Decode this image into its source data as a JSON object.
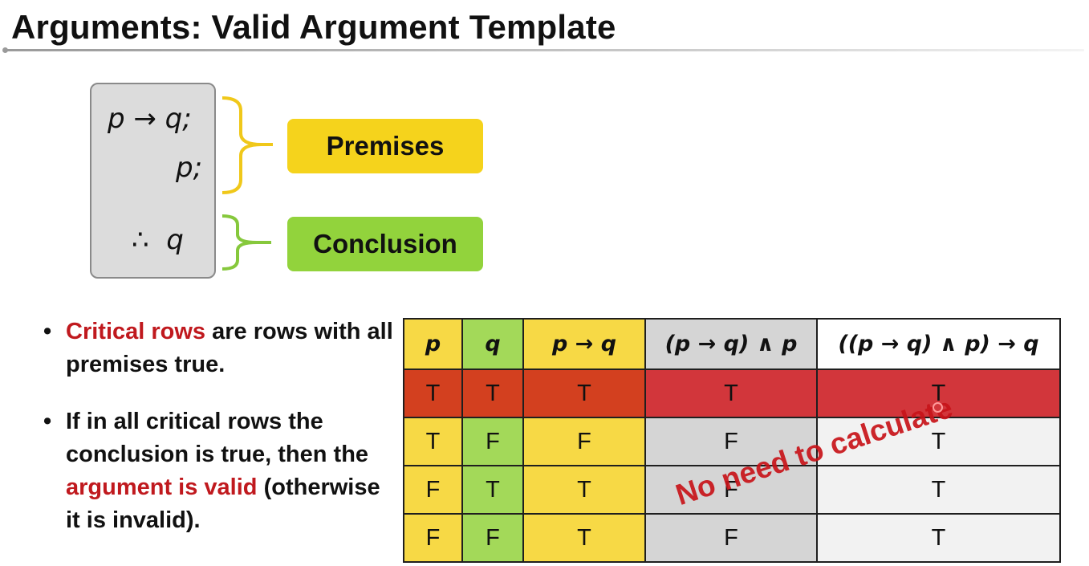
{
  "title": "Arguments: Valid Argument Template",
  "argument": {
    "line1": "p → q;",
    "line2": "p;",
    "line3": "∴  q"
  },
  "labels": {
    "premises": "Premises",
    "conclusion": "Conclusion"
  },
  "bullets": {
    "b1_highlight": "Critical rows",
    "b1_rest": " are rows with all premises true.",
    "b2_pre": "If in all critical rows the conclusion is true, then the ",
    "b2_highlight": "argument is valid",
    "b2_post": " (otherwise it is invalid).",
    "marker": "•"
  },
  "truth_table": {
    "headers": [
      "p",
      "q",
      "p → q",
      "(p → q) ∧ p",
      "((p → q) ∧ p) → q"
    ],
    "rows": [
      [
        "T",
        "T",
        "T",
        "T",
        "T"
      ],
      [
        "T",
        "F",
        "F",
        "F",
        "T"
      ],
      [
        "F",
        "T",
        "T",
        "F",
        "T"
      ],
      [
        "F",
        "F",
        "T",
        "F",
        "T"
      ]
    ],
    "critical_row_index": 0
  },
  "annotation": "No need to calculate",
  "colors": {
    "premises": "#f5d31c",
    "conclusion": "#92d33c",
    "highlight_red": "#c0191e",
    "critical_row": "#d2363b"
  }
}
